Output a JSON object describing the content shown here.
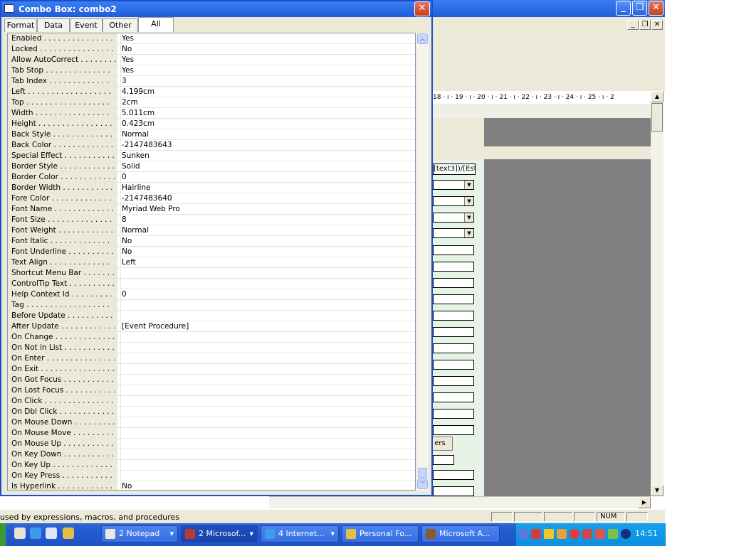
{
  "property_sheet": {
    "title": "Combo Box: combo2",
    "close_glyph": "✕",
    "tabs": [
      {
        "label": "Format",
        "active": false
      },
      {
        "label": "Data",
        "active": false
      },
      {
        "label": "Event",
        "active": false
      },
      {
        "label": "Other",
        "active": false
      },
      {
        "label": "All",
        "active": true
      }
    ],
    "rows": [
      {
        "name": "Enabled . . . . . . . . . . . . . . .",
        "value": "Yes"
      },
      {
        "name": "Locked . . . . . . . . . . . . . . . .",
        "value": "No"
      },
      {
        "name": "Allow AutoCorrect . . . . . . . .",
        "value": "Yes"
      },
      {
        "name": "Tab Stop . . . . . . . . . . . . . .",
        "value": "Yes"
      },
      {
        "name": "Tab Index . . . . . . . . . . . . .",
        "value": "3"
      },
      {
        "name": "Left . . . . . . . . . . . . . . . . . .",
        "value": "4.199cm"
      },
      {
        "name": "Top . . . . . . . . . . . . . . . . . .",
        "value": "2cm"
      },
      {
        "name": "Width . . . . . . . . . . . . . . . .",
        "value": "5.011cm"
      },
      {
        "name": "Height . . . . . . . . . . . . . . . .",
        "value": "0.423cm"
      },
      {
        "name": "Back Style . . . . . . . . . . . . .",
        "value": "Normal"
      },
      {
        "name": "Back Color . . . . . . . . . . . . .",
        "value": "-2147483643"
      },
      {
        "name": "Special Effect . . . . . . . . . . .",
        "value": "Sunken"
      },
      {
        "name": "Border Style . . . . . . . . . . . .",
        "value": "Solid"
      },
      {
        "name": "Border Color . . . . . . . . . . . .",
        "value": "0"
      },
      {
        "name": "Border Width . . . . . . . . . . .",
        "value": "Hairline"
      },
      {
        "name": "Fore Color . . . . . . . . . . . . .",
        "value": "-2147483640"
      },
      {
        "name": "Font Name . . . . . . . . . . . . .",
        "value": "Myriad Web Pro"
      },
      {
        "name": "Font Size . . . . . . . . . . . . . .",
        "value": "8"
      },
      {
        "name": "Font Weight . . . . . . . . . . . .",
        "value": "Normal"
      },
      {
        "name": "Font Italic . . . . . . . . . . . . .",
        "value": "No"
      },
      {
        "name": "Font Underline . . . . . . . . . .",
        "value": "No"
      },
      {
        "name": "Text Align . . . . . . . . . . . . .",
        "value": "Left"
      },
      {
        "name": "Shortcut Menu Bar . . . . . . .",
        "value": ""
      },
      {
        "name": "ControlTip Text . . . . . . . . . .",
        "value": ""
      },
      {
        "name": "Help Context Id . . . . . . . . .",
        "value": "0"
      },
      {
        "name": "Tag . . . . . . . . . . . . . . . . . .",
        "value": ""
      },
      {
        "name": "Before Update . . . . . . . . . .",
        "value": ""
      },
      {
        "name": "After Update . . . . . . . . . . . .",
        "value": "[Event Procedure]"
      },
      {
        "name": "On Change . . . . . . . . . . . . .",
        "value": ""
      },
      {
        "name": "On Not in List . . . . . . . . . . .",
        "value": ""
      },
      {
        "name": "On Enter . . . . . . . . . . . . . . .",
        "value": ""
      },
      {
        "name": "On Exit . . . . . . . . . . . . . . . .",
        "value": ""
      },
      {
        "name": "On Got Focus . . . . . . . . . . .",
        "value": ""
      },
      {
        "name": "On Lost Focus . . . . . . . . . . .",
        "value": ""
      },
      {
        "name": "On Click . . . . . . . . . . . . . . .",
        "value": ""
      },
      {
        "name": "On Dbl Click . . . . . . . . . . . .",
        "value": ""
      },
      {
        "name": "On Mouse Down . . . . . . . . .",
        "value": ""
      },
      {
        "name": "On Mouse Move . . . . . . . . .",
        "value": ""
      },
      {
        "name": "On Mouse Up . . . . . . . . . . .",
        "value": ""
      },
      {
        "name": "On Key Down . . . . . . . . . . .",
        "value": ""
      },
      {
        "name": "On Key Up . . . . . . . . . . . . .",
        "value": ""
      },
      {
        "name": "On Key Press . . . . . . . . . . .",
        "value": ""
      },
      {
        "name": "Is Hyperlink . . . . . . . . . . . .",
        "value": "No"
      }
    ]
  },
  "designer": {
    "ruler_text": "18 · ı · 19 · ı · 20 · ı · 21 · ı · 22 · ı · 23 · ı · 24 · ı · 25 · ı · 2",
    "field_label": "[text3])/[Est",
    "button_label": "ers",
    "window_buttons": {
      "minimize": "_",
      "restore": "❐",
      "close": "✕"
    }
  },
  "statusbar": {
    "text": "used by expressions, macros, and procedures",
    "num": "NUM"
  },
  "taskbar": {
    "buttons": [
      {
        "label": "2 Notepad",
        "active": false
      },
      {
        "label": "2 Microsof...",
        "active": true
      },
      {
        "label": "4 Internet...",
        "active": false
      },
      {
        "label": "Personal Fo...",
        "active": false
      },
      {
        "label": "Microsoft A...",
        "active": false
      }
    ],
    "clock": "14:51"
  },
  "colors": {
    "title_blue": "#1f5cd8",
    "taskbar_blue": "#245ad0",
    "tray_blue": "#0b8ee0",
    "detail_green": "#e6f3e6"
  }
}
